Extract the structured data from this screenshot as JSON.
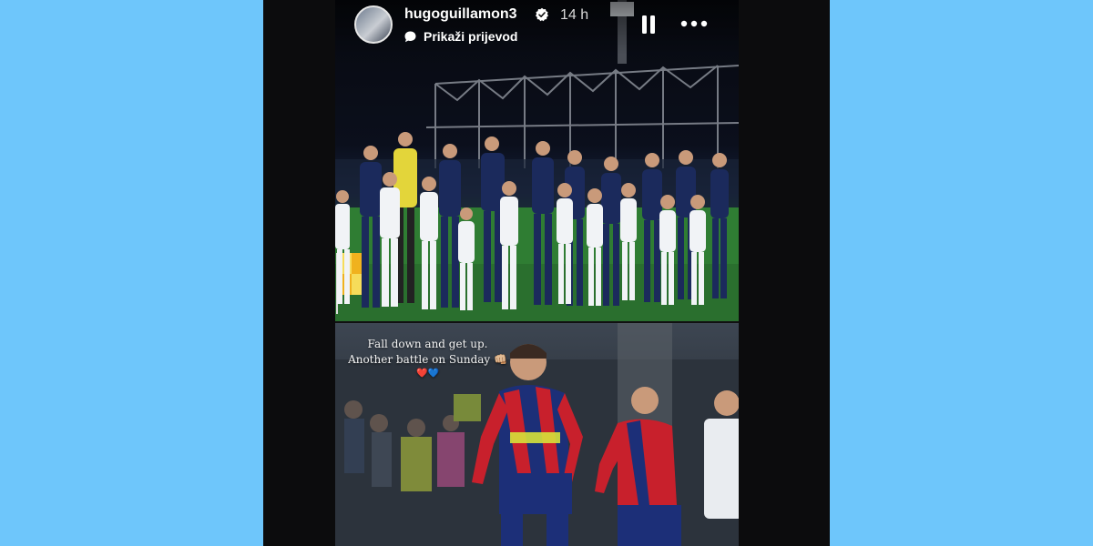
{
  "story": {
    "username": "hugoguillamon3",
    "time": "14 h",
    "translate_label": "Prikaži prijevod",
    "caption_line1": "Fall down and get up.",
    "caption_line2": "Another battle on Sunday 👊🏼",
    "caption_hearts": "❤️💙"
  },
  "colors": {
    "background": "#6ec6fb",
    "frame": "#0c0c0d",
    "verified_badge": "#ffffff",
    "team_home_red": "#c8202c",
    "team_home_blue": "#1c2f78",
    "team_away_navy": "#1b2a5c",
    "goalkeeper_yellow": "#e3d53a",
    "pitch_green": "#2f7d33"
  },
  "icons": {
    "verified": "verified-badge-icon",
    "translate": "speech-bubble-icon",
    "pause": "pause-icon",
    "more": "more-dots-icon"
  }
}
